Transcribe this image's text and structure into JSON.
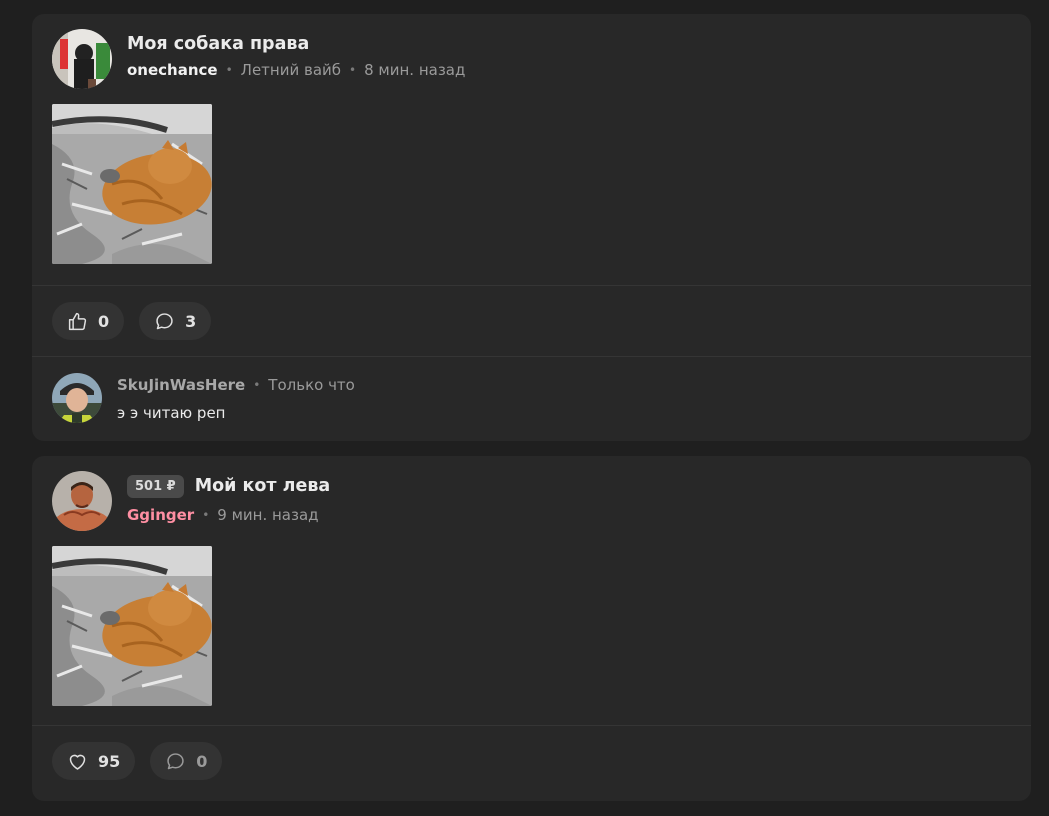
{
  "posts": [
    {
      "title": "Моя собака права",
      "author": "onechance",
      "community": "Летний вайб",
      "time": "8 мин. назад",
      "likes": "0",
      "comments": "3",
      "top_comment": {
        "user": "SkuJinWasHere",
        "time": "Только что",
        "text": "э э читаю реп"
      }
    },
    {
      "price": "501 ₽",
      "title": "Мой кот лева",
      "author": "Gginger",
      "time": "9 мин. назад",
      "likes": "95",
      "comments": "0"
    }
  ],
  "colors": {
    "card_bg": "#282828",
    "page_bg": "#1f1f1f",
    "pink_author": "#ff8fa3"
  }
}
